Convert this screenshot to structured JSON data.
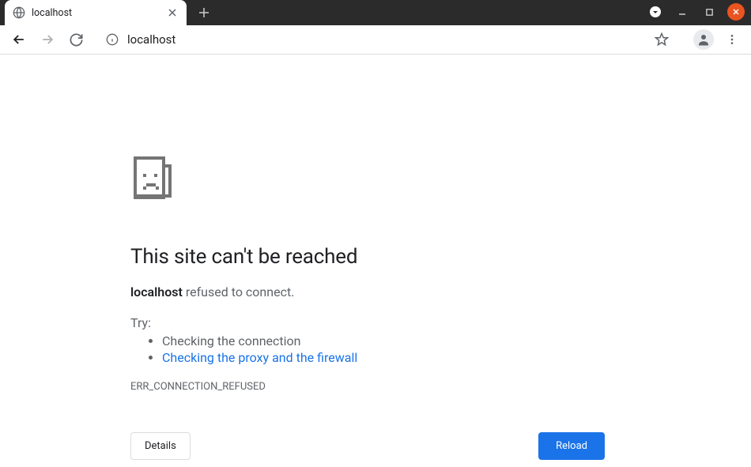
{
  "tab": {
    "title": "localhost"
  },
  "omnibox": {
    "url": "localhost"
  },
  "error": {
    "title": "This site can't be reached",
    "host": "localhost",
    "message_suffix": " refused to connect.",
    "try_label": "Try:",
    "suggestion1": "Checking the connection",
    "suggestion2": "Checking the proxy and the firewall",
    "code": "ERR_CONNECTION_REFUSED",
    "details_label": "Details",
    "reload_label": "Reload"
  }
}
